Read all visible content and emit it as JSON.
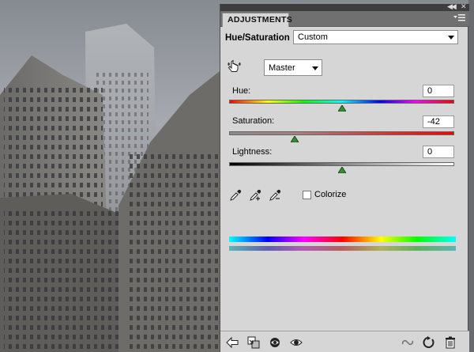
{
  "panel": {
    "tab_label": "ADJUSTMENTS",
    "collapse_icon": "double-chevron-right-icon",
    "menu_icon": "panel-menu-icon"
  },
  "adjustment": {
    "title": "Hue/Saturation",
    "preset_value": "Custom",
    "channel_value": "Master"
  },
  "sliders": {
    "hue": {
      "label": "Hue:",
      "value": "0",
      "fraction": 0.5
    },
    "saturation": {
      "label": "Saturation:",
      "value": "-42",
      "fraction": 0.29
    },
    "lightness": {
      "label": "Lightness:",
      "value": "0",
      "fraction": 0.5
    }
  },
  "colorize": {
    "label": "Colorize",
    "checked": false
  },
  "bottom_icons": [
    "back-arrow-icon",
    "clip-to-layer-icon",
    "visibility-toggle-icon",
    "view-previous-state-icon",
    "link-icon",
    "reset-icon",
    "trash-icon"
  ],
  "colors": {
    "panel_bg": "#d6d6d6",
    "tab_bar": "#707070"
  }
}
